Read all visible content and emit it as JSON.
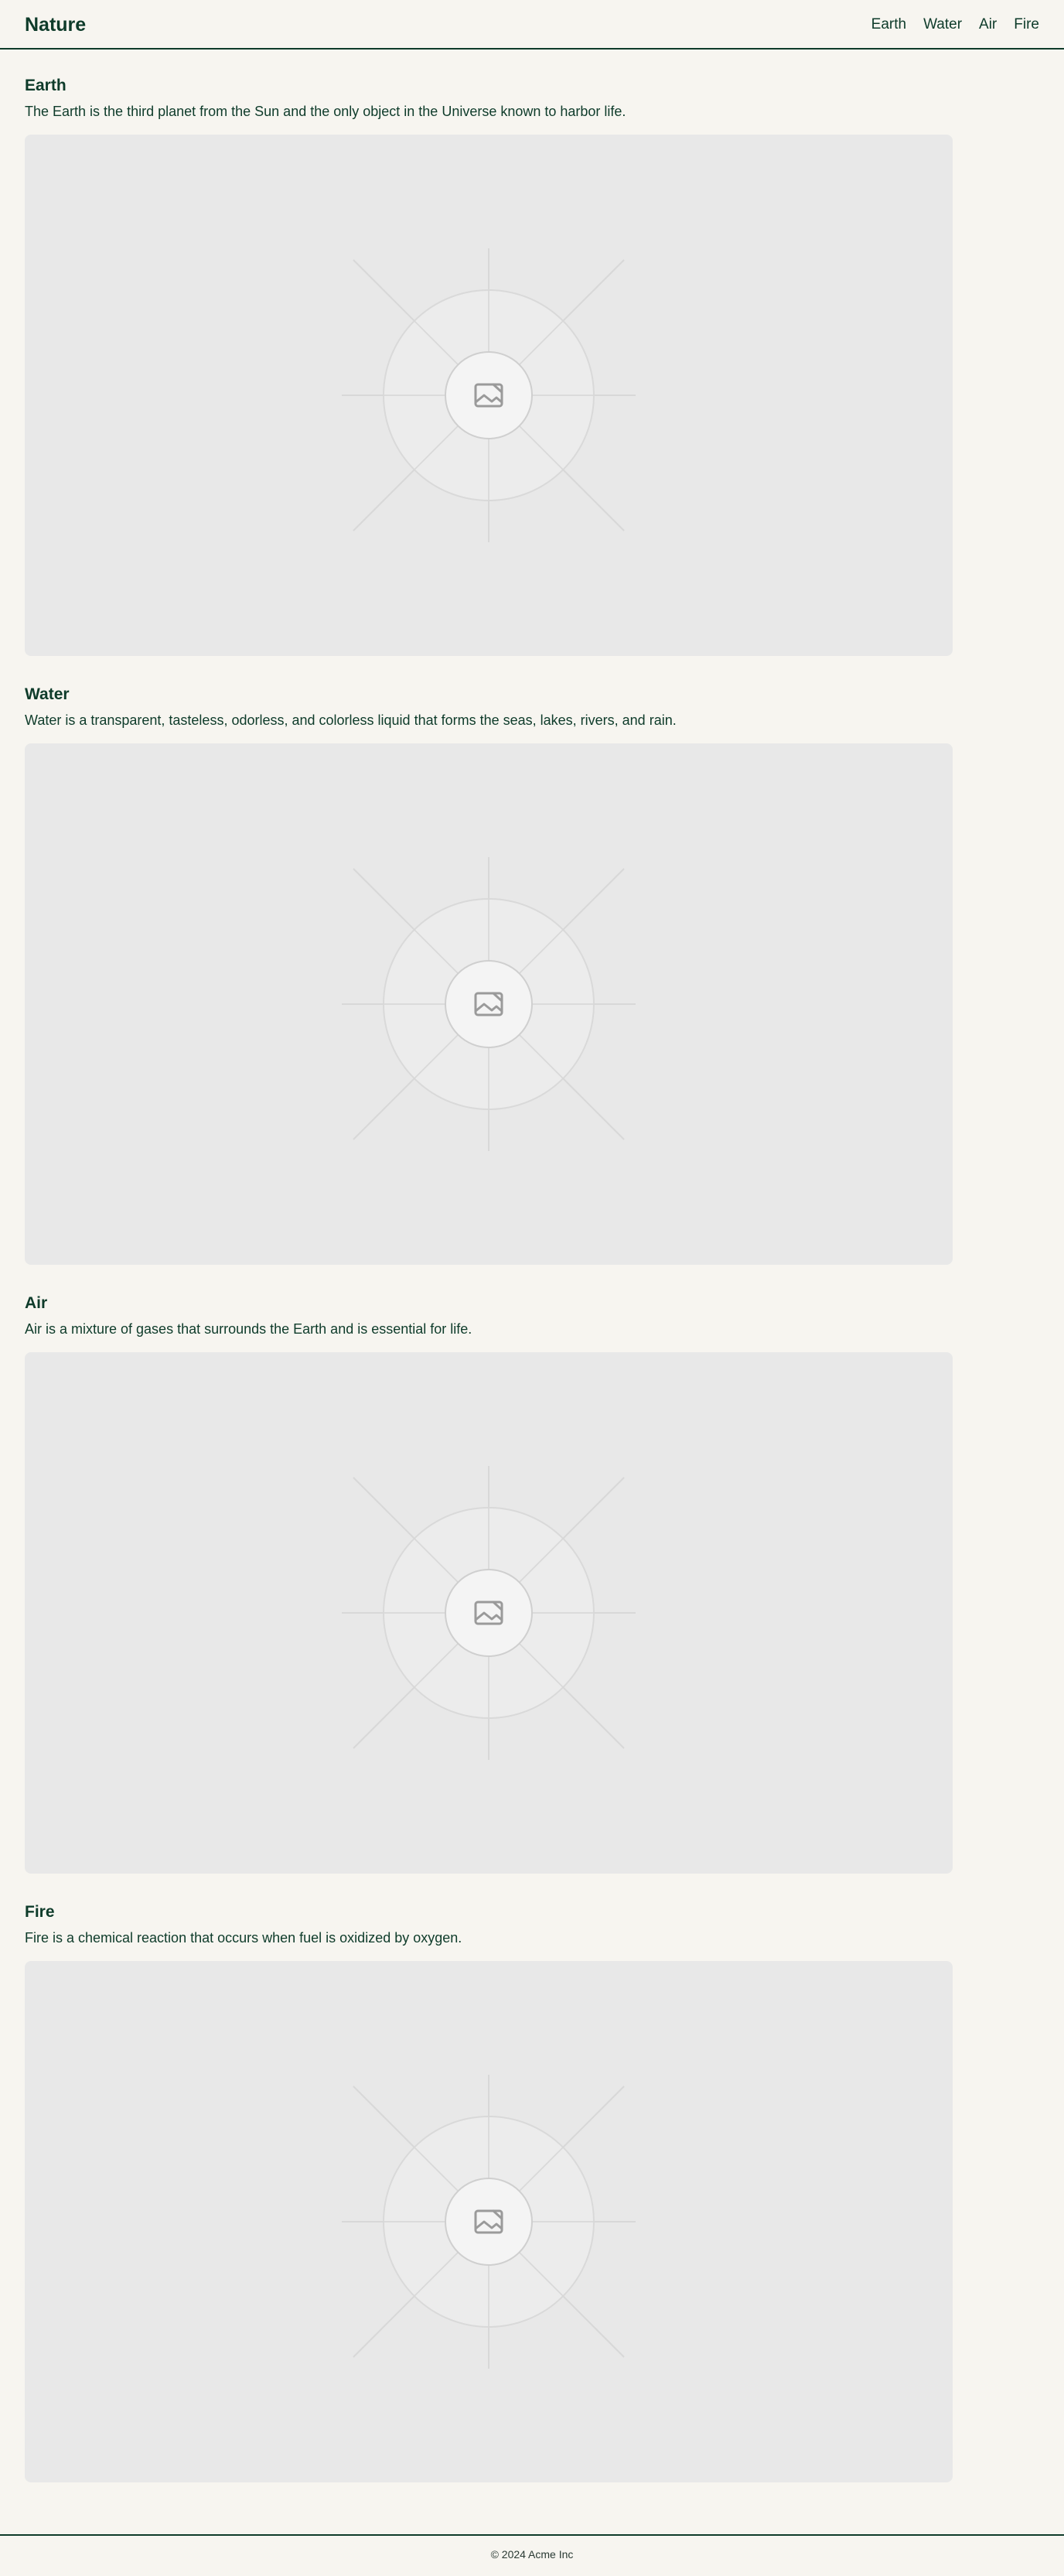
{
  "brand": "Nature",
  "nav": [
    "Earth",
    "Water",
    "Air",
    "Fire"
  ],
  "sections": [
    {
      "title": "Earth",
      "text": "The Earth is the third planet from the Sun and the only object in the Universe known to harbor life.",
      "image_icon": "image-placeholder-icon"
    },
    {
      "title": "Water",
      "text": "Water is a transparent, tasteless, odorless, and colorless liquid that forms the seas, lakes, rivers, and rain.",
      "image_icon": "image-placeholder-icon"
    },
    {
      "title": "Air",
      "text": "Air is a mixture of gases that surrounds the Earth and is essential for life.",
      "image_icon": "image-placeholder-icon"
    },
    {
      "title": "Fire",
      "text": "Fire is a chemical reaction that occurs when fuel is oxidized by oxygen.",
      "image_icon": "image-placeholder-icon"
    }
  ],
  "footer": "© 2024 Acme Inc",
  "colors": {
    "text": "#0e3b2a",
    "background": "#f7f5f0",
    "placeholder": "#e8e8e8"
  }
}
